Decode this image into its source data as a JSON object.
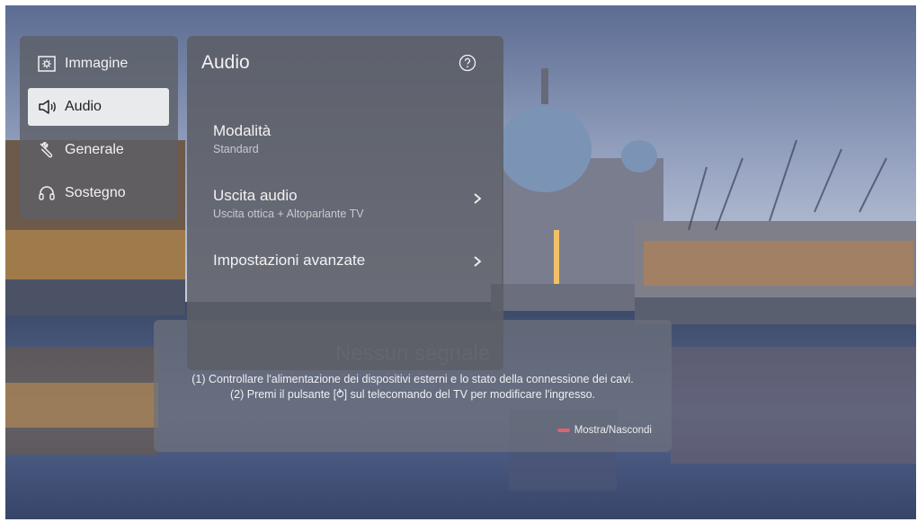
{
  "left_menu": {
    "items": [
      {
        "label": "Immagine",
        "icon": "picture-icon",
        "selected": false
      },
      {
        "label": "Audio",
        "icon": "speaker-icon",
        "selected": true
      },
      {
        "label": "Generale",
        "icon": "wrench-icon",
        "selected": false
      },
      {
        "label": "Sostegno",
        "icon": "headset-icon",
        "selected": false
      }
    ]
  },
  "audio_panel": {
    "title": "Audio",
    "help_icon": "help-icon",
    "options": [
      {
        "title": "Modalità",
        "value": "Standard"
      },
      {
        "title": "Uscita audio",
        "value": "Uscita ottica + Altoparlante TV",
        "chevron": "chevron-right-icon"
      },
      {
        "title": "Impostazioni avanzate",
        "chevron": "chevron-right-icon"
      }
    ]
  },
  "no_signal": {
    "title": "Nessun segnale",
    "line1": "(1) Controllare l'alimentazione dei dispositivi esterni e lo stato della connessione dei cavi.",
    "line2": "(2) Premi il pulsante [⥁] sul telecomando del TV per modificare l'ingresso.",
    "toggle_label": "Mostra/Nascondi",
    "toggle_key_color": "#e06070"
  }
}
